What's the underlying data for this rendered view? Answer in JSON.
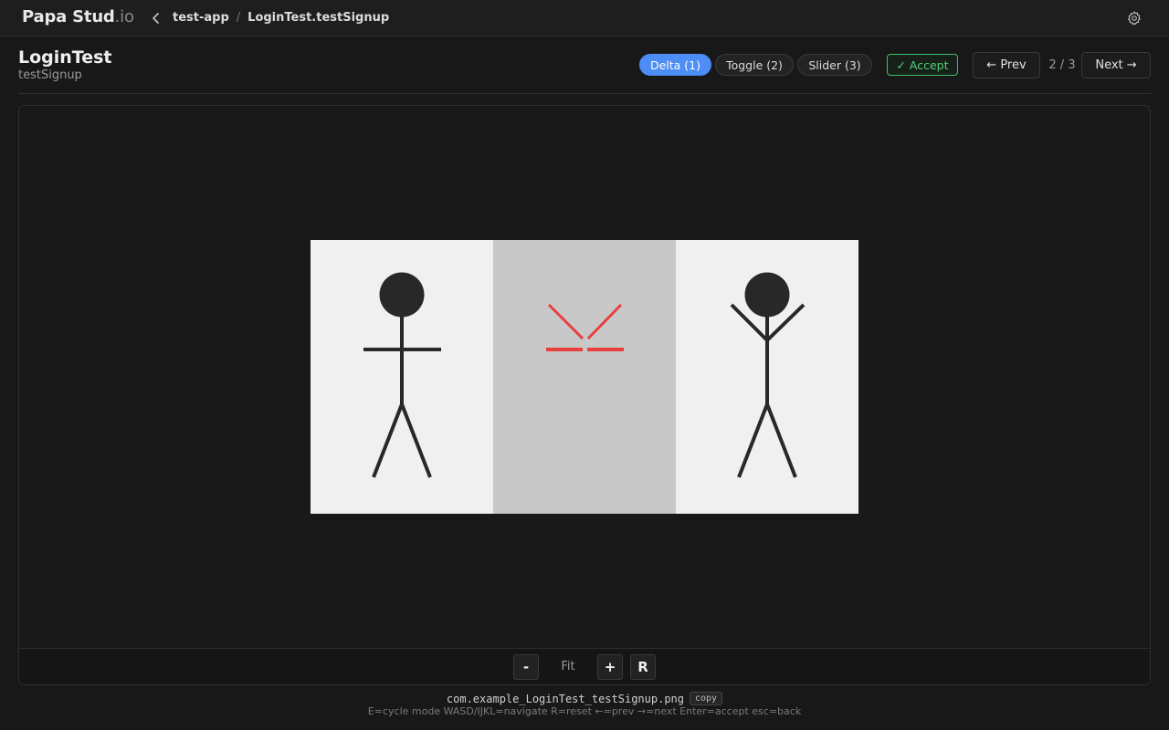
{
  "app": {
    "brand_main": "Papa Stud",
    "brand_suffix": ".io"
  },
  "breadcrumb": {
    "project": "test-app",
    "separator": "/",
    "test": "LoginTest.testSignup"
  },
  "header": {
    "title": "LoginTest",
    "subtitle": "testSignup"
  },
  "modes": [
    {
      "label": "Delta (1)",
      "active": true
    },
    {
      "label": "Toggle (2)",
      "active": false
    },
    {
      "label": "Slider (3)",
      "active": false
    }
  ],
  "actions": {
    "accept_label": "✓ Accept",
    "prev_label": "← Prev",
    "next_label": "Next →",
    "counter": "2 / 3"
  },
  "toolbar": {
    "zoom_out": "-",
    "fit": "Fit",
    "zoom_in": "+",
    "reset": "R"
  },
  "footer": {
    "filename": "com.example_LoginTest_testSignup.png",
    "copy_label": "copy",
    "hint": "E=cycle mode WASD/IJKL=navigate R=reset ←=prev →=next Enter=accept esc=back"
  },
  "colors": {
    "accent": "#4d8df6",
    "accept": "#4fd37c",
    "diff_highlight": "#e83e3e",
    "panel_bg": "#f0f0f0",
    "delta_bg": "#c8c8c8"
  },
  "icons": {
    "back": "chevron-left-icon",
    "settings": "gear-icon"
  }
}
